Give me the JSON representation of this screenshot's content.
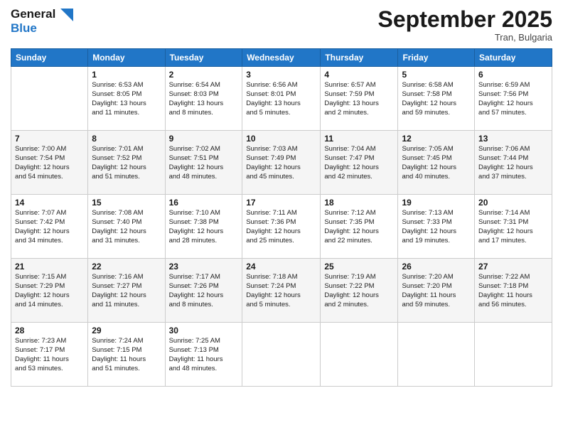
{
  "logo": {
    "line1": "General",
    "line2": "Blue"
  },
  "title": "September 2025",
  "subtitle": "Tran, Bulgaria",
  "days_of_week": [
    "Sunday",
    "Monday",
    "Tuesday",
    "Wednesday",
    "Thursday",
    "Friday",
    "Saturday"
  ],
  "weeks": [
    [
      {
        "day": "",
        "info": ""
      },
      {
        "day": "1",
        "info": "Sunrise: 6:53 AM\nSunset: 8:05 PM\nDaylight: 13 hours\nand 11 minutes."
      },
      {
        "day": "2",
        "info": "Sunrise: 6:54 AM\nSunset: 8:03 PM\nDaylight: 13 hours\nand 8 minutes."
      },
      {
        "day": "3",
        "info": "Sunrise: 6:56 AM\nSunset: 8:01 PM\nDaylight: 13 hours\nand 5 minutes."
      },
      {
        "day": "4",
        "info": "Sunrise: 6:57 AM\nSunset: 7:59 PM\nDaylight: 13 hours\nand 2 minutes."
      },
      {
        "day": "5",
        "info": "Sunrise: 6:58 AM\nSunset: 7:58 PM\nDaylight: 12 hours\nand 59 minutes."
      },
      {
        "day": "6",
        "info": "Sunrise: 6:59 AM\nSunset: 7:56 PM\nDaylight: 12 hours\nand 57 minutes."
      }
    ],
    [
      {
        "day": "7",
        "info": "Sunrise: 7:00 AM\nSunset: 7:54 PM\nDaylight: 12 hours\nand 54 minutes."
      },
      {
        "day": "8",
        "info": "Sunrise: 7:01 AM\nSunset: 7:52 PM\nDaylight: 12 hours\nand 51 minutes."
      },
      {
        "day": "9",
        "info": "Sunrise: 7:02 AM\nSunset: 7:51 PM\nDaylight: 12 hours\nand 48 minutes."
      },
      {
        "day": "10",
        "info": "Sunrise: 7:03 AM\nSunset: 7:49 PM\nDaylight: 12 hours\nand 45 minutes."
      },
      {
        "day": "11",
        "info": "Sunrise: 7:04 AM\nSunset: 7:47 PM\nDaylight: 12 hours\nand 42 minutes."
      },
      {
        "day": "12",
        "info": "Sunrise: 7:05 AM\nSunset: 7:45 PM\nDaylight: 12 hours\nand 40 minutes."
      },
      {
        "day": "13",
        "info": "Sunrise: 7:06 AM\nSunset: 7:44 PM\nDaylight: 12 hours\nand 37 minutes."
      }
    ],
    [
      {
        "day": "14",
        "info": "Sunrise: 7:07 AM\nSunset: 7:42 PM\nDaylight: 12 hours\nand 34 minutes."
      },
      {
        "day": "15",
        "info": "Sunrise: 7:08 AM\nSunset: 7:40 PM\nDaylight: 12 hours\nand 31 minutes."
      },
      {
        "day": "16",
        "info": "Sunrise: 7:10 AM\nSunset: 7:38 PM\nDaylight: 12 hours\nand 28 minutes."
      },
      {
        "day": "17",
        "info": "Sunrise: 7:11 AM\nSunset: 7:36 PM\nDaylight: 12 hours\nand 25 minutes."
      },
      {
        "day": "18",
        "info": "Sunrise: 7:12 AM\nSunset: 7:35 PM\nDaylight: 12 hours\nand 22 minutes."
      },
      {
        "day": "19",
        "info": "Sunrise: 7:13 AM\nSunset: 7:33 PM\nDaylight: 12 hours\nand 19 minutes."
      },
      {
        "day": "20",
        "info": "Sunrise: 7:14 AM\nSunset: 7:31 PM\nDaylight: 12 hours\nand 17 minutes."
      }
    ],
    [
      {
        "day": "21",
        "info": "Sunrise: 7:15 AM\nSunset: 7:29 PM\nDaylight: 12 hours\nand 14 minutes."
      },
      {
        "day": "22",
        "info": "Sunrise: 7:16 AM\nSunset: 7:27 PM\nDaylight: 12 hours\nand 11 minutes."
      },
      {
        "day": "23",
        "info": "Sunrise: 7:17 AM\nSunset: 7:26 PM\nDaylight: 12 hours\nand 8 minutes."
      },
      {
        "day": "24",
        "info": "Sunrise: 7:18 AM\nSunset: 7:24 PM\nDaylight: 12 hours\nand 5 minutes."
      },
      {
        "day": "25",
        "info": "Sunrise: 7:19 AM\nSunset: 7:22 PM\nDaylight: 12 hours\nand 2 minutes."
      },
      {
        "day": "26",
        "info": "Sunrise: 7:20 AM\nSunset: 7:20 PM\nDaylight: 11 hours\nand 59 minutes."
      },
      {
        "day": "27",
        "info": "Sunrise: 7:22 AM\nSunset: 7:18 PM\nDaylight: 11 hours\nand 56 minutes."
      }
    ],
    [
      {
        "day": "28",
        "info": "Sunrise: 7:23 AM\nSunset: 7:17 PM\nDaylight: 11 hours\nand 53 minutes."
      },
      {
        "day": "29",
        "info": "Sunrise: 7:24 AM\nSunset: 7:15 PM\nDaylight: 11 hours\nand 51 minutes."
      },
      {
        "day": "30",
        "info": "Sunrise: 7:25 AM\nSunset: 7:13 PM\nDaylight: 11 hours\nand 48 minutes."
      },
      {
        "day": "",
        "info": ""
      },
      {
        "day": "",
        "info": ""
      },
      {
        "day": "",
        "info": ""
      },
      {
        "day": "",
        "info": ""
      }
    ]
  ]
}
